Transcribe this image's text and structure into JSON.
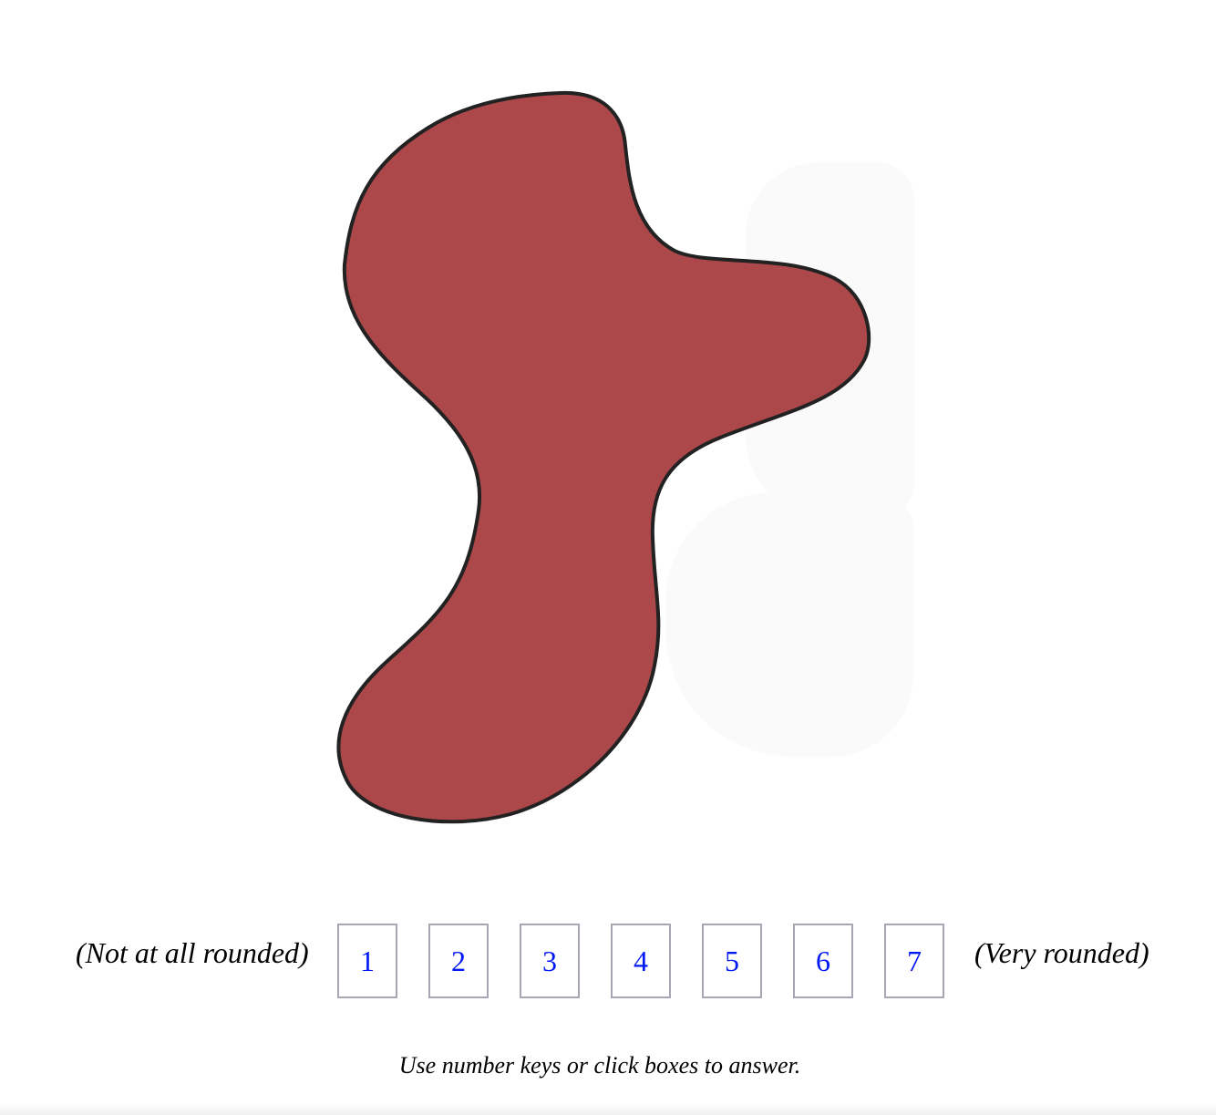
{
  "shape": {
    "name": "red blob",
    "fill_color": "#ad484a",
    "stroke_color": "#222222"
  },
  "rating_scale": {
    "left_anchor": "(Not at all rounded)",
    "right_anchor": "(Very rounded)",
    "options": [
      "1",
      "2",
      "3",
      "4",
      "5",
      "6",
      "7"
    ],
    "box_text_color": "#0019f5",
    "box_border_color": "#a7a7b3"
  },
  "instructions": "Use number keys or click boxes to answer."
}
